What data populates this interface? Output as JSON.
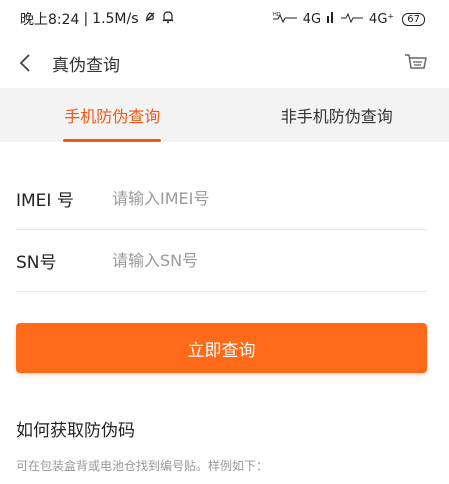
{
  "status_bar": {
    "time": "晚上8:24",
    "network_speed": "1.5M/s",
    "signal_1": "4G",
    "signal_2": "4G⁺",
    "battery": "67"
  },
  "nav": {
    "title": "真伪查询",
    "back_icon": "chevron-left-icon",
    "cart_icon": "cart-icon"
  },
  "tabs": [
    {
      "label": "手机防伪查询",
      "active": true
    },
    {
      "label": "非手机防伪查询",
      "active": false
    }
  ],
  "form": {
    "imei": {
      "label": "IMEI 号",
      "placeholder": "请输入IMEI号",
      "value": ""
    },
    "sn": {
      "label": "SN号",
      "placeholder": "请输入SN号",
      "value": ""
    }
  },
  "submit_label": "立即查询",
  "help": {
    "title": "如何获取防伪码",
    "description": "可在包装盒背或电池仓找到编号贴。样例如下："
  },
  "colors": {
    "accent": "#f05a19",
    "button": "#ff6a1a",
    "tab_bg": "#f3f3f3"
  }
}
